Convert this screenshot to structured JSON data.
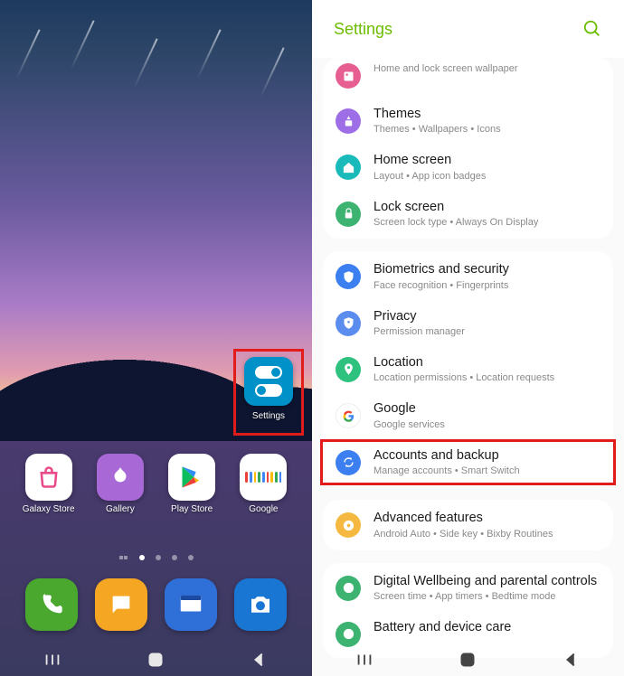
{
  "home": {
    "settings_label": "Settings",
    "apps": [
      {
        "name": "Galaxy Store"
      },
      {
        "name": "Gallery"
      },
      {
        "name": "Play Store"
      },
      {
        "name": "Google"
      }
    ]
  },
  "settings": {
    "title": "Settings",
    "groups": [
      [
        {
          "icon": "wallpaper",
          "icon_class": "c-pink",
          "title": "",
          "sub": "Home and lock screen wallpaper",
          "cut_top": true
        },
        {
          "icon": "themes",
          "icon_class": "c-purple",
          "title": "Themes",
          "sub": "Themes  •  Wallpapers  •  Icons"
        },
        {
          "icon": "home",
          "icon_class": "c-teal",
          "title": "Home screen",
          "sub": "Layout  •  App icon badges"
        },
        {
          "icon": "lock",
          "icon_class": "c-green",
          "title": "Lock screen",
          "sub": "Screen lock type  •  Always On Display"
        }
      ],
      [
        {
          "icon": "shield",
          "icon_class": "c-blue",
          "title": "Biometrics and security",
          "sub": "Face recognition  •  Fingerprints"
        },
        {
          "icon": "privacy",
          "icon_class": "c-blue2",
          "title": "Privacy",
          "sub": "Permission manager"
        },
        {
          "icon": "location",
          "icon_class": "c-loc",
          "title": "Location",
          "sub": "Location permissions  •  Location requests"
        },
        {
          "icon": "google",
          "icon_class": "c-multi",
          "title": "Google",
          "sub": "Google services"
        },
        {
          "icon": "sync",
          "icon_class": "c-sync",
          "title": "Accounts and backup",
          "sub": "Manage accounts  •  Smart Switch",
          "highlight": true
        }
      ],
      [
        {
          "icon": "advanced",
          "icon_class": "c-adv",
          "title": "Advanced features",
          "sub": "Android Auto  •  Side key  •  Bixby Routines"
        }
      ],
      [
        {
          "icon": "wellbeing",
          "icon_class": "c-well",
          "title": "Digital Wellbeing and parental controls",
          "sub": "Screen time  •  App timers  •  Bedtime mode"
        },
        {
          "icon": "battery",
          "icon_class": "c-bat",
          "title": "Battery and device care",
          "sub": "",
          "cut_bottom": true
        }
      ]
    ]
  }
}
